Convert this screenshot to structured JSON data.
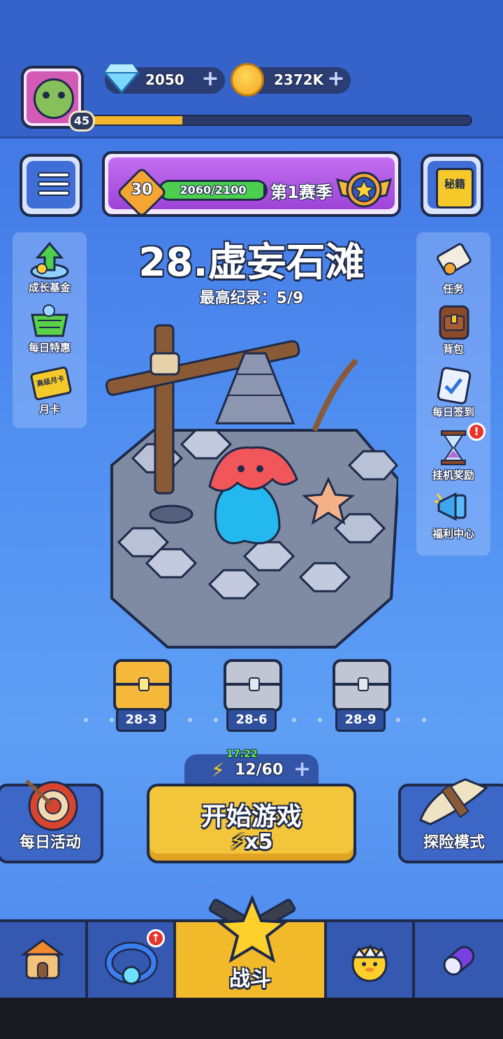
{
  "player": {
    "level": "45",
    "xp_fraction": 0.24
  },
  "currency": {
    "gems": "2050",
    "coins": "2372K",
    "plus": "+"
  },
  "season": {
    "level": "30",
    "progress_text": "2060/2100",
    "progress_fraction": 0.98,
    "title": "第1赛季"
  },
  "secret_button": {
    "label": "秘籍"
  },
  "left_panel": [
    {
      "label": "成长基金",
      "icon": "growth-fund-icon"
    },
    {
      "label": "每日特惠",
      "icon": "shopping-basket-icon"
    },
    {
      "label": "月卡",
      "sublabel": "高级月卡",
      "icon": "monthly-card-icon"
    }
  ],
  "right_panel": [
    {
      "label": "任务",
      "icon": "scroll-icon"
    },
    {
      "label": "背包",
      "icon": "backpack-icon"
    },
    {
      "label": "每日签到",
      "icon": "checkin-clipboard-icon"
    },
    {
      "label": "挂机奖励",
      "icon": "hourglass-icon",
      "badge": "!"
    },
    {
      "label": "福利中心",
      "icon": "megaphone-icon"
    }
  ],
  "stage": {
    "title": "28.虚妄石滩",
    "record": "最高纪录：5/9"
  },
  "chests": [
    {
      "label": "28-3",
      "state": "unlocked"
    },
    {
      "label": "28-6",
      "state": "locked"
    },
    {
      "label": "28-9",
      "state": "locked"
    }
  ],
  "energy": {
    "timer": "17:22",
    "value": "12/60",
    "plus": "+"
  },
  "start_button": {
    "title": "开始游戏",
    "cost": "x5"
  },
  "daily_events": {
    "label": "每日活动"
  },
  "explore_mode": {
    "label": "探险模式"
  },
  "nav": {
    "battle_label": "战斗",
    "upgrade_badge": "↑"
  },
  "colors": {
    "accent_yellow": "#f3c53a",
    "purple_panel": "#9d44d8",
    "progress_green": "#4ccf4e",
    "dark_outline": "#1e2a4a"
  }
}
